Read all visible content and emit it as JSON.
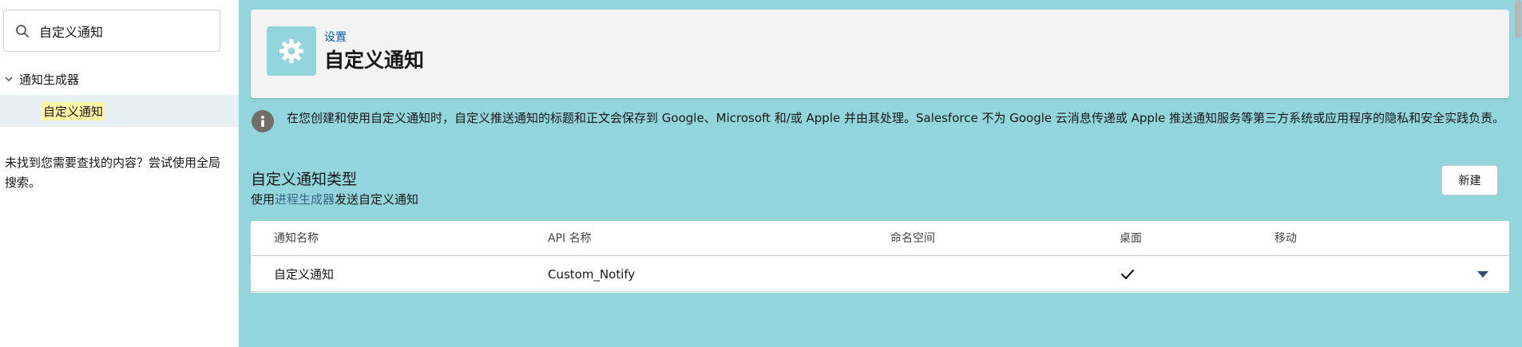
{
  "sidebar": {
    "search": {
      "value": "自定义通知",
      "icon": "search-icon"
    },
    "tree": {
      "parent": {
        "label": "通知生成器",
        "icon": "chevron-down-icon"
      },
      "child": {
        "label": "自定义通知"
      }
    },
    "help_text": "未找到您需要查找的内容？尝试使用全局搜索。"
  },
  "header": {
    "icon": "gear-icon",
    "breadcrumb": "设置",
    "title": "自定义通知"
  },
  "info": {
    "icon": "info-icon",
    "text": "在您创建和使用自定义通知时，自定义推送通知的标题和正文会保存到 Google、Microsoft 和/或 Apple 并由其处理。Salesforce 不为 Google 云消息传递或 Apple 推送通知服务等第三方系统或应用程序的隐私和安全实践负责。"
  },
  "section": {
    "title": "自定义通知类型",
    "subtitle_prefix": "使用",
    "subtitle_link": "进程生成器",
    "subtitle_suffix": "发送自定义通知",
    "new_button": "新建"
  },
  "table": {
    "columns": [
      "通知名称",
      "API 名称",
      "命名空间",
      "桌面",
      "移动"
    ],
    "rows": [
      {
        "name": "自定义通知",
        "api_name": "Custom_Notify",
        "namespace": "",
        "desktop": "checkmark-icon",
        "mobile": ""
      }
    ]
  },
  "colors": {
    "main_bg": "#93d5dc",
    "link": "#0b5cab",
    "highlight": "#fff6a6"
  }
}
